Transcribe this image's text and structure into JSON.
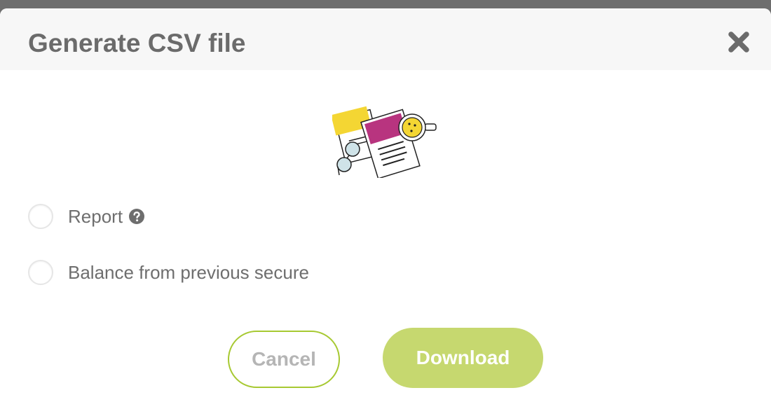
{
  "dialog": {
    "title": "Generate CSV file",
    "close_icon": "close-icon"
  },
  "options": [
    {
      "label": "Report",
      "selected": false,
      "has_help": true,
      "help_icon": "question-circle-icon"
    },
    {
      "label": "Balance from previous secure",
      "selected": false,
      "has_help": false
    }
  ],
  "buttons": {
    "cancel_label": "Cancel",
    "download_label": "Download"
  },
  "colors": {
    "accent": "#a7c932",
    "download_bg": "#c6d86f",
    "text": "#6e6e6e",
    "illustration_yellow": "#f4d633",
    "illustration_magenta": "#b8347f"
  }
}
